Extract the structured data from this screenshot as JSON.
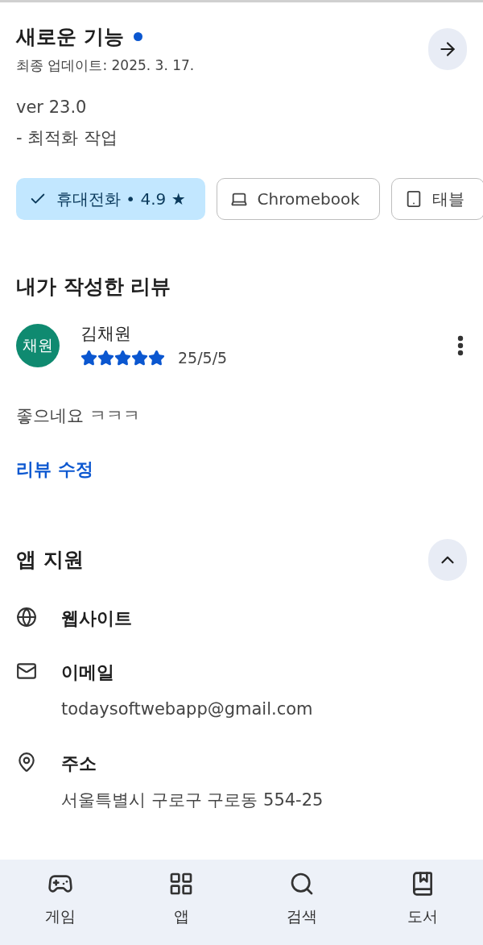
{
  "whats_new": {
    "title": "새로운 기능",
    "unread": true,
    "updated": "최종 업데이트: 2025. 3. 17.",
    "notes": [
      "ver 23.0",
      "- 최적화 작업"
    ]
  },
  "device_chips": [
    {
      "kind": "phone",
      "label": "휴대전화 • 4.9 ★",
      "selected": true
    },
    {
      "kind": "laptop",
      "label": "Chromebook",
      "selected": false
    },
    {
      "kind": "tablet",
      "label": "태블",
      "selected": false
    }
  ],
  "my_review": {
    "heading": "내가 작성한 리뷰",
    "avatar": "채원",
    "author": "김채원",
    "stars": 5,
    "date": "25/5/5",
    "text": "좋으네요 ㅋㅋㅋ",
    "edit_link": "리뷰 수정"
  },
  "app_support": {
    "heading": "앱 지원",
    "expanded": true,
    "items": [
      {
        "kind": "website",
        "label": "웹사이트"
      },
      {
        "kind": "email",
        "label": "이메일",
        "detail": "todaysoftwebapp@gmail.com"
      },
      {
        "kind": "address",
        "label": "주소",
        "detail": "서울특별시 구로구 구로동 554-25"
      }
    ]
  },
  "bottom_nav": [
    {
      "kind": "games",
      "label": "게임"
    },
    {
      "kind": "apps",
      "label": "앱"
    },
    {
      "kind": "search",
      "label": "검색"
    },
    {
      "kind": "books",
      "label": "도서"
    }
  ]
}
